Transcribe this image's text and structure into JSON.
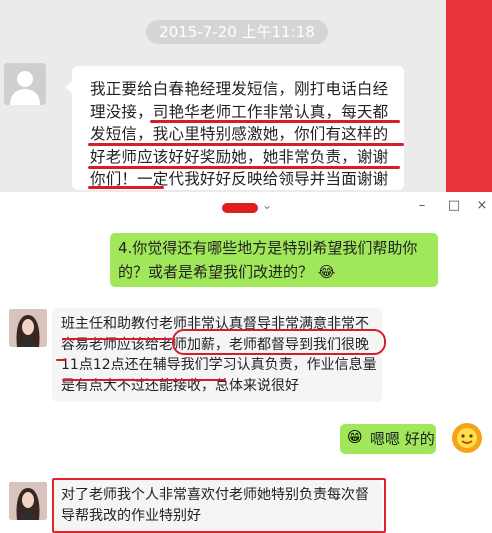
{
  "top": {
    "timestamp": "2015-7-20 上午11:18",
    "message": "我正要给白春艳经理发短信，刚打电话白经理没接，司艳华老师工作非常认真，每天都发短信，我心里特别感激她，你们有这样的好老师应该好好奖励她，她非常负责，谢谢你们！一定代我好好反映给领导并当面谢谢司老师，拜托了。"
  },
  "bottom": {
    "window_controls": [
      "⌄",
      "–",
      "□",
      "×"
    ],
    "outgoing_question": "4.你觉得还有哪些地方是特别希望我们帮助你的？或者是希望我们改进的？",
    "emoji1": "😂",
    "reply1": "班主任和助教付老师非常认真督导非常满意非常不容易老师应该给老师加薪，老师都督导到我们很晚11点12点还在辅导我们学习认真负责，作业信息量是有点大不过还能接收，总体来说很好",
    "outgoing_reply": "嗯嗯 好的",
    "emoji2": "😁",
    "reply2": "对了老师我个人非常喜欢付老师她特别负责每次督导帮我改的作业特别好"
  }
}
